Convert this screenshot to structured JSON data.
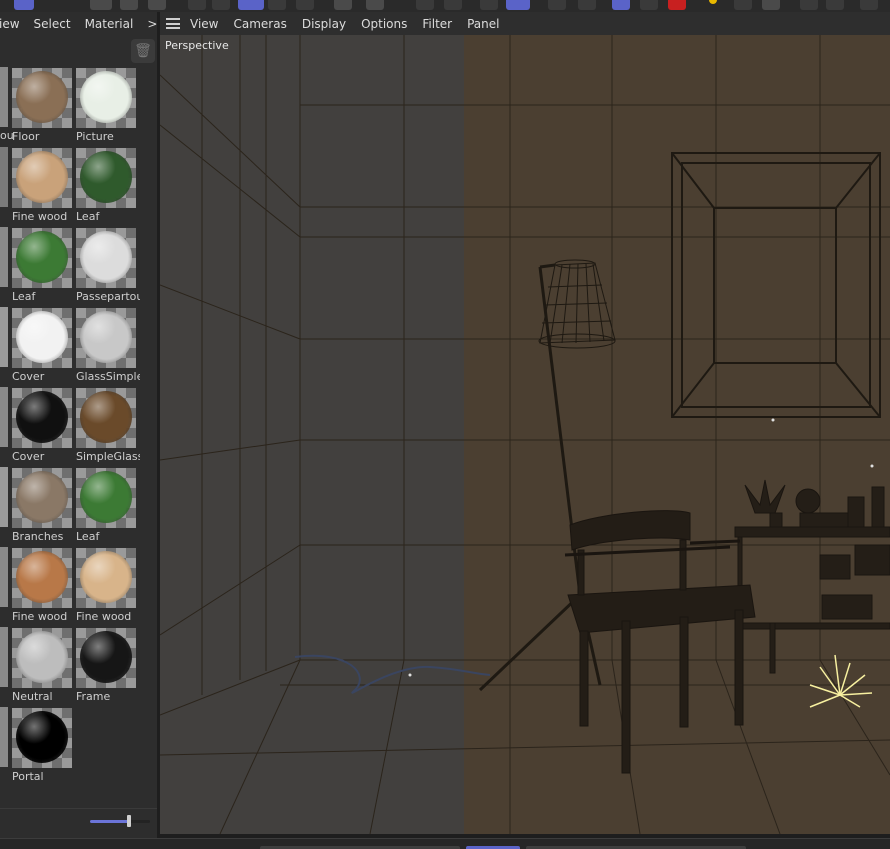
{
  "toolbar": {
    "icons": [
      "render-icon",
      "record-icon",
      "cube-icon",
      "pen-icon",
      "spline-icon",
      "camera-icon",
      "light-icon",
      "snap-icon",
      "grid-icon"
    ]
  },
  "material_manager": {
    "menu": [
      "iew",
      "Select",
      "Material",
      ">"
    ],
    "materials": [
      {
        "name": "Floor",
        "color": "#8a6f55"
      },
      {
        "name": "Picture",
        "color": "#e8efe6"
      },
      {
        "name": "Fine wood",
        "color": "#c9a27a"
      },
      {
        "name": "Leaf",
        "color": "#2f5a2c"
      },
      {
        "name": "Leaf",
        "color": "#3c7a34"
      },
      {
        "name": "Passepartout",
        "color": "#dcdcdc"
      },
      {
        "name": "Cover",
        "color": "#f2f2f2"
      },
      {
        "name": "GlassSimple",
        "color": "#c8c8c8"
      },
      {
        "name": "Cover",
        "color": "#101010"
      },
      {
        "name": "SimpleGlass",
        "color": "#6a4a2a"
      },
      {
        "name": "Branches",
        "color": "#8a7866"
      },
      {
        "name": "Leaf",
        "color": "#3c7a34"
      },
      {
        "name": "Fine wood",
        "color": "#b87848"
      },
      {
        "name": "Fine wood",
        "color": "#d8b48a"
      },
      {
        "name": "Neutral",
        "color": "#bdbdbd"
      },
      {
        "name": "Frame",
        "color": "#161616"
      },
      {
        "name": "Portal",
        "color": "#000000"
      }
    ],
    "partial_left_labels": [
      "ou"
    ],
    "zoom_slider": 0.65
  },
  "viewport": {
    "menu": [
      "View",
      "Cameras",
      "Display",
      "Options",
      "Filter",
      "Panel"
    ],
    "label": "Perspective",
    "colors": {
      "room": "#4b3f31",
      "overlay": "#414141",
      "lines": "#2a2218",
      "light": "#f7f0a0"
    }
  }
}
